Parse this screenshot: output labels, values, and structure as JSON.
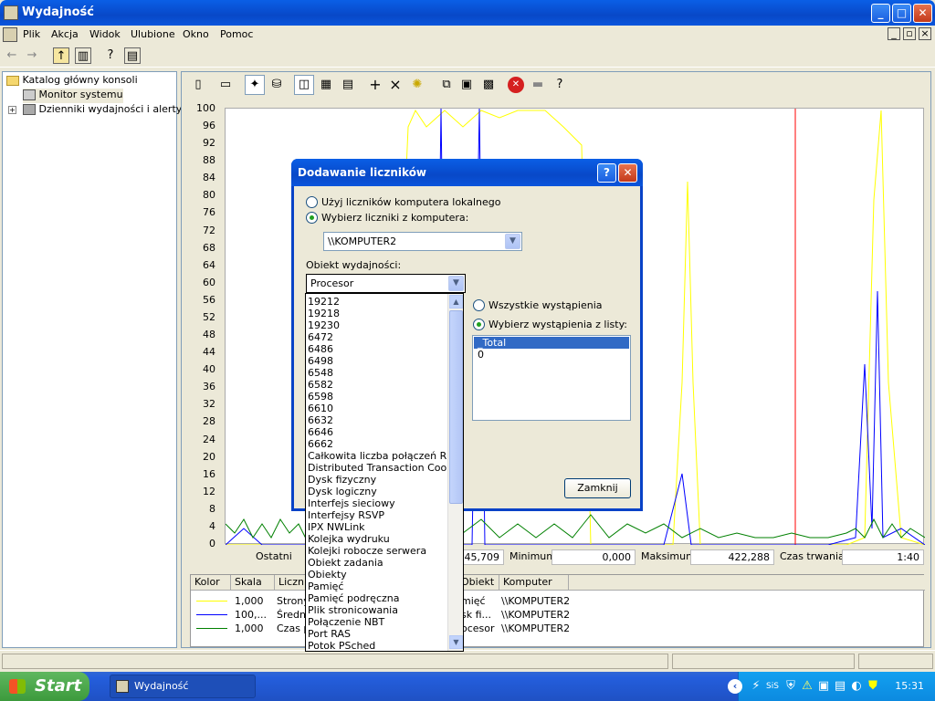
{
  "window": {
    "title": "Wydajność",
    "min": "_",
    "max": "□",
    "close": "✕"
  },
  "menu": [
    "Plik",
    "Akcja",
    "Widok",
    "Ulubione",
    "Okno",
    "Pomoc"
  ],
  "tree": {
    "root": "Katalog główny konsoli",
    "items": [
      "Monitor systemu",
      "Dzienniki wydajności i alerty"
    ],
    "expander": "+"
  },
  "graph": {
    "y_ticks": [
      "100",
      "96",
      "92",
      "88",
      "84",
      "80",
      "76",
      "72",
      "68",
      "64",
      "60",
      "56",
      "52",
      "48",
      "44",
      "40",
      "36",
      "32",
      "28",
      "24",
      "20",
      "16",
      "12",
      "8",
      "4",
      "0"
    ],
    "series_colors": {
      "yellow": "#ffff00",
      "blue": "#0000ff",
      "green": "#008000",
      "cursor": "#ff0000"
    }
  },
  "stats": {
    "last_label": "Ostatni",
    "last_value": "45,709",
    "min_label": "Minimum",
    "min_value": "0,000",
    "max_label": "Maksimum",
    "max_value": "422,288",
    "dur_label": "Czas trwania",
    "dur_value": "1:40"
  },
  "legend": {
    "headers": [
      "Kolor",
      "Skala",
      "Licznik",
      "Obiekt",
      "Komputer"
    ],
    "rows": [
      {
        "scale": "1,000",
        "counter": "Strony",
        "object": "mięć",
        "computer": "\\\\KOMPUTER2",
        "color": "#ffff00"
      },
      {
        "scale": "100,...",
        "counter": "Średni",
        "object": "sk fi...",
        "computer": "\\\\KOMPUTER2",
        "color": "#0000ff"
      },
      {
        "scale": "1,000",
        "counter": "Czas p",
        "object": "ocesor",
        "computer": "\\\\KOMPUTER2",
        "color": "#008000"
      }
    ]
  },
  "dialog": {
    "title": "Dodawanie liczników",
    "help": "?",
    "close": "✕",
    "radio_local": "Użyj liczników komputera lokalnego",
    "radio_remote": "Wybierz liczniki z komputera:",
    "computer": "\\\\KOMPUTER2",
    "object_label": "Obiekt wydajności:",
    "object_value": "Procesor",
    "radio_all": "Wszystkie wystąpienia",
    "radio_list": "Wybierz wystąpienia z listy:",
    "instances": [
      "_Total",
      "0"
    ],
    "close_btn": "Zamknij",
    "objects": [
      "19212",
      "19218",
      "19230",
      "6472",
      "6486",
      "6498",
      "6548",
      "6582",
      "6598",
      "6610",
      "6632",
      "6646",
      "6662",
      "Całkowita liczba połączeń RAS",
      "Distributed Transaction Coordina",
      "Dysk fizyczny",
      "Dysk logiczny",
      "Interfejs sieciowy",
      "Interfejsy RSVP",
      "IPX NWLink",
      "Kolejka wydruku",
      "Kolejki robocze serwera",
      "Obiekt zadania",
      "Obiekty",
      "Pamięć",
      "Pamięć podręczna",
      "Plik stronicowania",
      "Połączenie NBT",
      "Port RAS",
      "Potok PSched"
    ]
  },
  "taskbar": {
    "start": "Start",
    "task": "Wydajność",
    "clock": "15:31"
  }
}
